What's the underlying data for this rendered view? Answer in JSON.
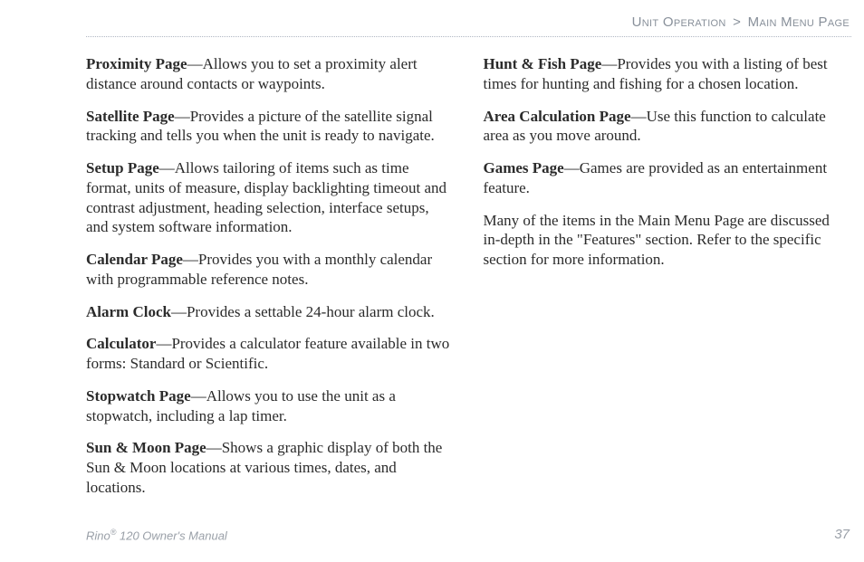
{
  "breadcrumb": {
    "section": "Unit Operation",
    "sep": ">",
    "page": "Main Menu Page"
  },
  "items": [
    {
      "term": "Proximity Page",
      "desc": "—Allows you to set a proximity alert distance around contacts or waypoints."
    },
    {
      "term": "Satellite Page",
      "desc": "—Provides a picture of the satellite signal tracking and tells you when the unit is ready to navigate."
    },
    {
      "term": "Setup Page",
      "desc": "—Allows tailoring of items such as time format, units of measure, display backlighting timeout and contrast adjustment, heading selection, interface setups, and system software information."
    },
    {
      "term": "Calendar Page",
      "desc": "—Provides you with a monthly calendar with programmable reference notes."
    },
    {
      "term": "Alarm Clock",
      "desc": "—Provides a settable 24-hour alarm clock."
    },
    {
      "term": "Calculator",
      "desc": "—Provides a calculator feature available in two forms: Standard or Scientific."
    },
    {
      "term": "Stopwatch Page",
      "desc": "—Allows you to use the unit as a stopwatch, including a lap timer."
    },
    {
      "term": "Sun & Moon Page",
      "desc": "—Shows a graphic display of both the Sun & Moon locations at various times, dates, and locations."
    },
    {
      "term": "Hunt & Fish Page",
      "desc": "—Provides you with a listing of best times for hunting and fishing for a chosen location."
    },
    {
      "term": "Area Calculation Page",
      "desc": "—Use this function to calculate area as you move around."
    },
    {
      "term": "Games Page",
      "desc": "—Games are provided as an entertainment feature."
    }
  ],
  "note": "Many of the items in the Main Menu Page are discussed in-depth in the \"Features\" section. Refer to the specific section for more information.",
  "footer": {
    "product_prefix": "Rino",
    "reg": "®",
    "product_suffix": " 120 Owner's Manual",
    "page_number": "37"
  }
}
